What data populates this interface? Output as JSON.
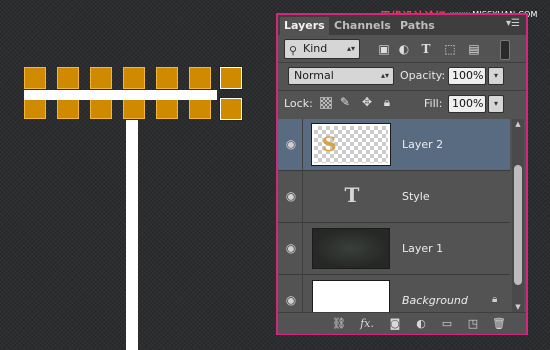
{
  "watermark": {
    "site": "思缘设计论坛",
    "url": "www.MISSYUAN.COM"
  },
  "panel": {
    "tabs": [
      {
        "label": "Layers",
        "active": true
      },
      {
        "label": "Channels",
        "active": false
      },
      {
        "label": "Paths",
        "active": false
      }
    ],
    "menu_icon": "panel-menu-icon",
    "filter": {
      "kind_label": "Kind",
      "icons": [
        "pixel-layer-filter-icon",
        "adjustment-layer-filter-icon",
        "type-layer-filter-icon",
        "shape-layer-filter-icon",
        "smart-object-filter-icon"
      ]
    },
    "blend": {
      "mode": "Normal",
      "opacity_label": "Opacity:",
      "opacity_value": "100%"
    },
    "lock": {
      "label": "Lock:",
      "icons": [
        "lock-transparent-pixels-icon",
        "lock-image-pixels-icon",
        "lock-position-icon",
        "lock-all-icon"
      ],
      "fill_label": "Fill:",
      "fill_value": "100%"
    },
    "layers": [
      {
        "name": "Layer 2",
        "thumb": "checker",
        "selected": true,
        "thumb_glyph": "S"
      },
      {
        "name": "Style",
        "thumb": "type",
        "selected": false,
        "type_glyph": "T"
      },
      {
        "name": "Layer 1",
        "thumb": "dark",
        "selected": false
      },
      {
        "name": "Background",
        "thumb": "white",
        "selected": false,
        "italic": true,
        "locked": true
      }
    ],
    "footer_icons": [
      "link-layers-icon",
      "fx-icon",
      "add-mask-icon",
      "adjustment-layer-icon",
      "new-group-icon",
      "new-layer-icon",
      "delete-layer-icon"
    ],
    "footer_fx_label": "fx."
  },
  "colors": {
    "accent_border": "#d3267e",
    "selected_row": "#596b81",
    "square_fill": "#d08a00"
  }
}
